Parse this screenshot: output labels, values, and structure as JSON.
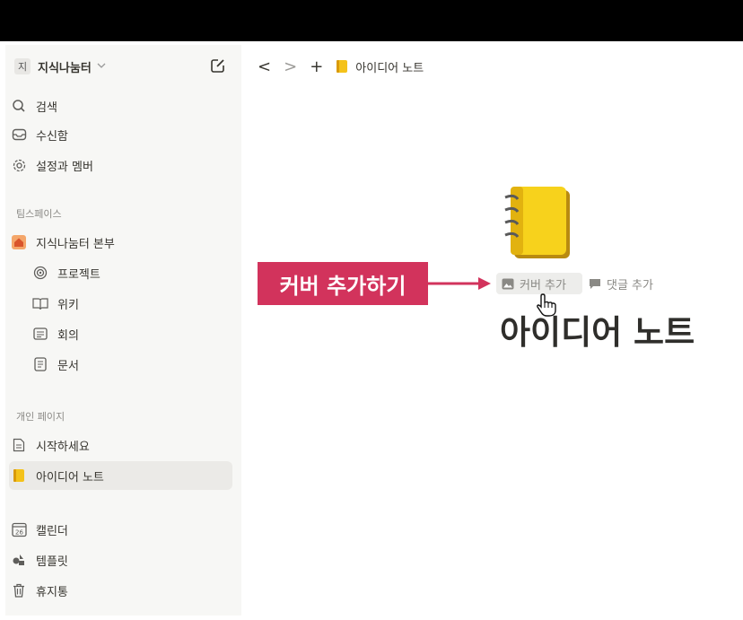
{
  "workspace": {
    "initial": "지",
    "name": "지식나눔터",
    "chevron": "chevron-down-icon"
  },
  "sidebar": {
    "search": "검색",
    "inbox": "수신함",
    "settings": "설정과 멤버",
    "teamspace_header": "팀스페이스",
    "teamspace": "지식나눔터 본부",
    "team_items": [
      "프로젝트",
      "위키",
      "회의",
      "문서"
    ],
    "personal_header": "개인 페이지",
    "personal_items": [
      "시작하세요",
      "아이디어 노트"
    ],
    "calendar": "캘린더",
    "calendar_day": "26",
    "templates": "템플릿",
    "trash": "휴지통"
  },
  "nav": {
    "back": "<",
    "forward": ">",
    "add": "+",
    "breadcrumb": "아이디어 노트"
  },
  "annotation": {
    "label": "커버 추가하기",
    "color": "#d2335c"
  },
  "page_actions": {
    "add_cover": "커버 추가",
    "add_comment": "댓글 추가"
  },
  "page": {
    "title": "아이디어 노트",
    "icon": "notebook-icon"
  }
}
